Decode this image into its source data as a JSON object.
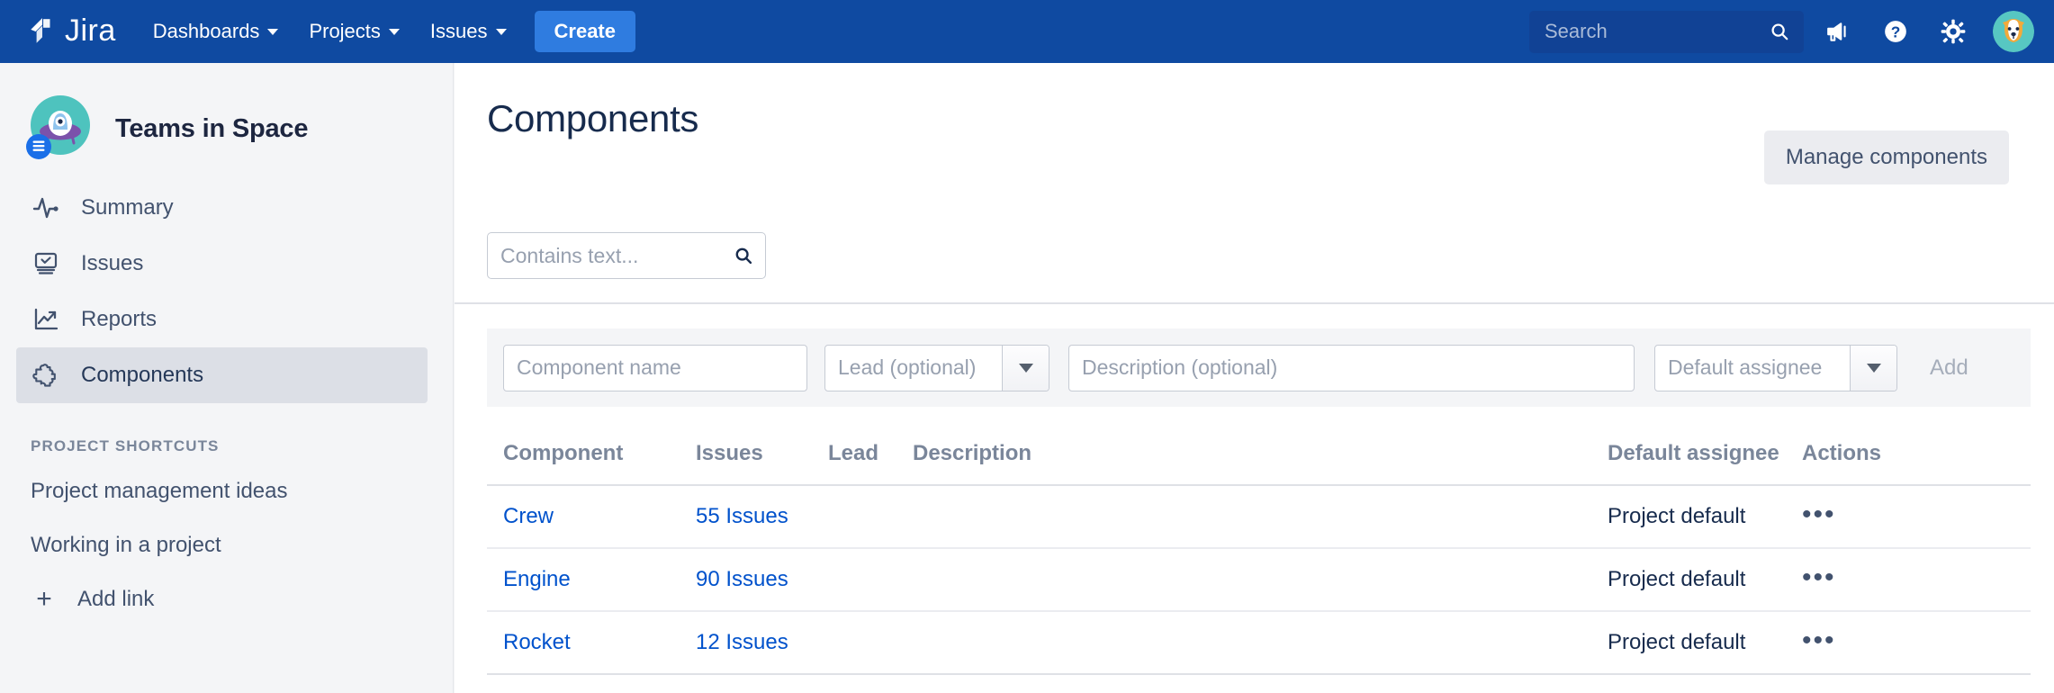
{
  "navbar": {
    "brand": "Jira",
    "brand_icon": "jira-logo-icon",
    "items": [
      {
        "label": "Dashboards",
        "has_caret": true
      },
      {
        "label": "Projects",
        "has_caret": true
      },
      {
        "label": "Issues",
        "has_caret": true
      }
    ],
    "create_label": "Create",
    "search": {
      "value": "",
      "placeholder": "Search",
      "icon": "search-icon"
    },
    "icons": [
      {
        "name": "announcement-megaphone-icon"
      },
      {
        "name": "help-question-icon"
      },
      {
        "name": "settings-gear-icon"
      }
    ],
    "avatar": {
      "name": "user-avatar-dog",
      "alt": "User profile"
    },
    "colors": {
      "background": "#0f4aa1",
      "search_background": "#114295",
      "create_button": "#2f7ce0"
    }
  },
  "sidebar": {
    "project_name": "Teams in Space",
    "project_avatar_icon": "project-avatar-ufo-icon",
    "items": [
      {
        "label": "Summary",
        "icon": "pulse-line-icon",
        "active": false
      },
      {
        "label": "Issues",
        "icon": "monitor-check-icon",
        "active": false
      },
      {
        "label": "Reports",
        "icon": "chart-trend-up-icon",
        "active": false
      },
      {
        "label": "Components",
        "icon": "puzzle-piece-icon",
        "active": true
      }
    ],
    "shortcuts_title": "PROJECT SHORTCUTS",
    "shortcuts": [
      {
        "label": "Project management ideas"
      },
      {
        "label": "Working in a project"
      }
    ],
    "add_link_label": "Add link",
    "add_link_icon": "plus-icon"
  },
  "main": {
    "title": "Components",
    "manage_button": "Manage components",
    "filter": {
      "value": "",
      "placeholder": "Contains text...",
      "icon": "search-icon"
    },
    "add_row": {
      "name_field": {
        "value": "",
        "placeholder": "Component name"
      },
      "lead_field": {
        "value": "",
        "placeholder": "Lead (optional)"
      },
      "description_field": {
        "value": "",
        "placeholder": "Description (optional)"
      },
      "assignee_field": {
        "value": "",
        "placeholder": "Default assignee"
      },
      "add_label": "Add"
    },
    "table": {
      "headers": {
        "component": "Component",
        "issues": "Issues",
        "lead": "Lead",
        "description": "Description",
        "assignee": "Default assignee",
        "actions": "Actions"
      },
      "rows": [
        {
          "component": "Crew",
          "issues": "55 Issues",
          "lead": "",
          "description": "",
          "assignee": "Project default",
          "actions": "•••"
        },
        {
          "component": "Engine",
          "issues": "90 Issues",
          "lead": "",
          "description": "",
          "assignee": "Project default",
          "actions": "•••"
        },
        {
          "component": "Rocket",
          "issues": "12 Issues",
          "lead": "",
          "description": "",
          "assignee": "Project default",
          "actions": "•••"
        }
      ]
    }
  }
}
